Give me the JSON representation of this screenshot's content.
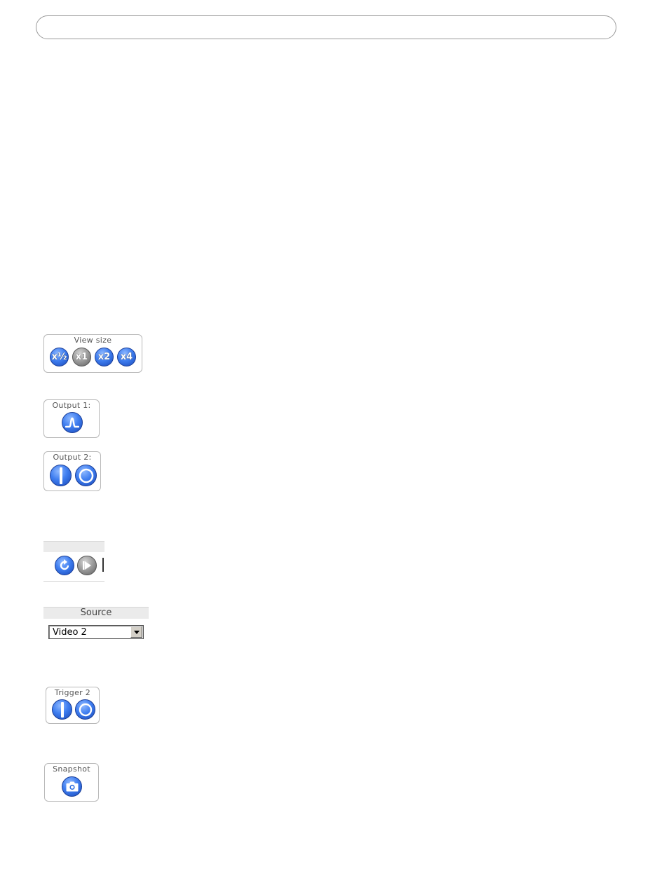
{
  "view_size": {
    "label": "View size",
    "buttons": [
      "x½",
      "x1",
      "x2",
      "x4"
    ]
  },
  "output1": {
    "label": "Output 1:"
  },
  "output2": {
    "label": "Output 2:"
  },
  "source": {
    "label": "Source",
    "selected": "Video 2"
  },
  "trigger": {
    "label": "Trigger 2"
  },
  "snapshot": {
    "label": "Snapshot"
  },
  "icons": {
    "pulse": "pulse-icon",
    "on": "on-icon",
    "off": "off-icon",
    "refresh": "refresh-icon",
    "play": "play-icon",
    "camera": "camera-icon",
    "dropdown": "chevron-down-icon"
  },
  "colors": {
    "button_active": "#2f6fe0",
    "button_inactive": "#8a8a8a"
  }
}
